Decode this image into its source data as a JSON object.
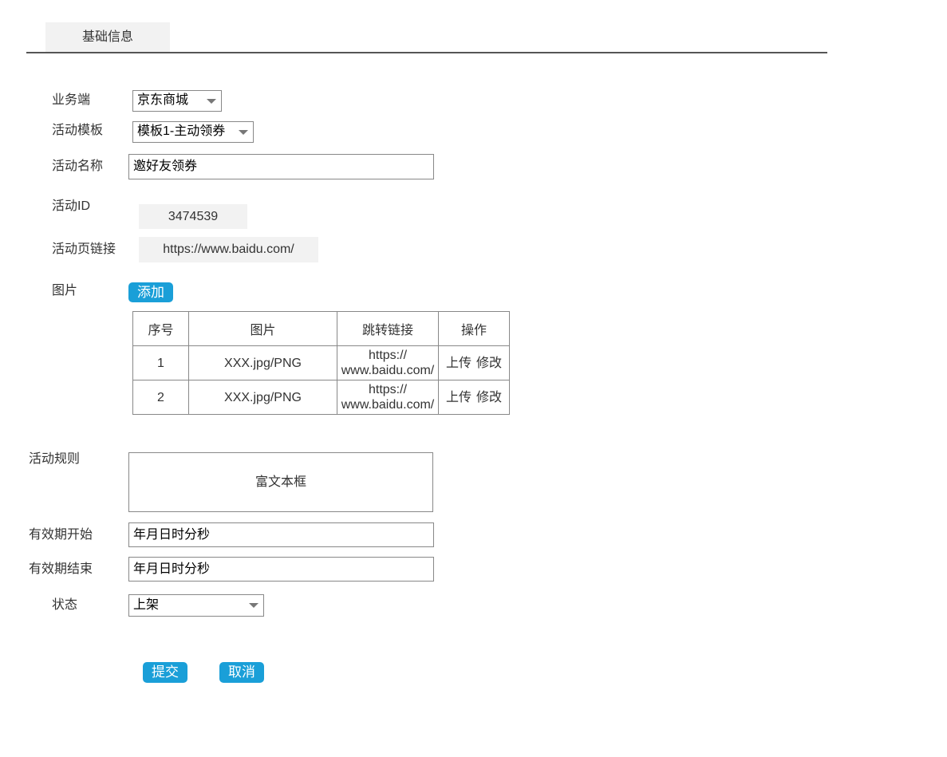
{
  "tabs": [
    {
      "label": "基础信息"
    }
  ],
  "form": {
    "business": {
      "label": "业务端",
      "value": "京东商城"
    },
    "template": {
      "label": "活动模板",
      "value": "模板1-主动领券"
    },
    "name": {
      "label": "活动名称",
      "value": "邀好友领券"
    },
    "activity_id": {
      "label": "活动ID",
      "value": "3474539"
    },
    "page_link": {
      "label": "活动页链接",
      "value": "https://www.baidu.com/"
    },
    "image": {
      "label": "图片",
      "add_button": "添加"
    },
    "rules": {
      "label": "活动规则",
      "placeholder": "富文本框"
    },
    "valid_start": {
      "label": "有效期开始",
      "value": "年月日时分秒"
    },
    "valid_end": {
      "label": "有效期结束",
      "value": "年月日时分秒"
    },
    "status": {
      "label": "状态",
      "value": "上架"
    }
  },
  "image_table": {
    "headers": [
      "序号",
      "图片",
      "跳转链接",
      "操作"
    ],
    "rows": [
      {
        "index": "1",
        "image": "XXX.jpg/PNG",
        "link_line1": "https://",
        "link_line2": "www.baidu.com/",
        "upload": "上传",
        "edit": "修改"
      },
      {
        "index": "2",
        "image": "XXX.jpg/PNG",
        "link_line1": "https://",
        "link_line2": "www.baidu.com/",
        "upload": "上传",
        "edit": "修改"
      }
    ]
  },
  "actions": {
    "submit": "提交",
    "cancel": "取消"
  },
  "colors": {
    "accent": "#1a9fd8",
    "tab_bg": "#f2f2f2",
    "border": "#888888"
  }
}
